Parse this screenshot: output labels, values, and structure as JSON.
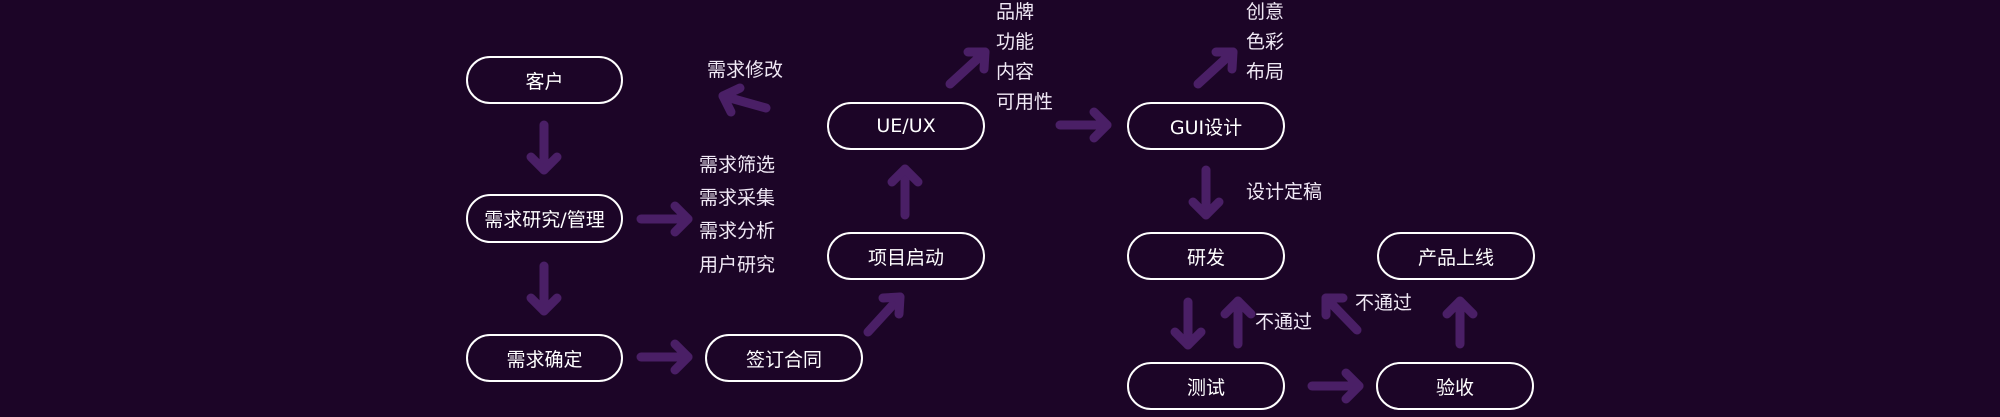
{
  "nodes": {
    "customer": "客户",
    "research": "需求研究/管理",
    "confirm": "需求确定",
    "contract": "签订合同",
    "kickoff": "项目启动",
    "ueux": "UE/UX",
    "gui": "GUI设计",
    "dev": "研发",
    "test": "测试",
    "accept": "验收",
    "launch": "产品上线"
  },
  "labels": {
    "revise": "需求修改",
    "filter": "需求筛选",
    "collect": "需求采集",
    "analyze": "需求分析",
    "user_research": "用户研究",
    "brand": "品牌",
    "function": "功能",
    "content": "内容",
    "usability": "可用性",
    "creative": "创意",
    "color": "色彩",
    "layout": "布局",
    "finalize": "设计定稿",
    "fail_1": "不通过",
    "fail_2": "不通过"
  },
  "colors": {
    "background": "#1c0527",
    "node_border": "#ffffff",
    "arrow": "#4a1f66",
    "text": "#ffffff"
  }
}
